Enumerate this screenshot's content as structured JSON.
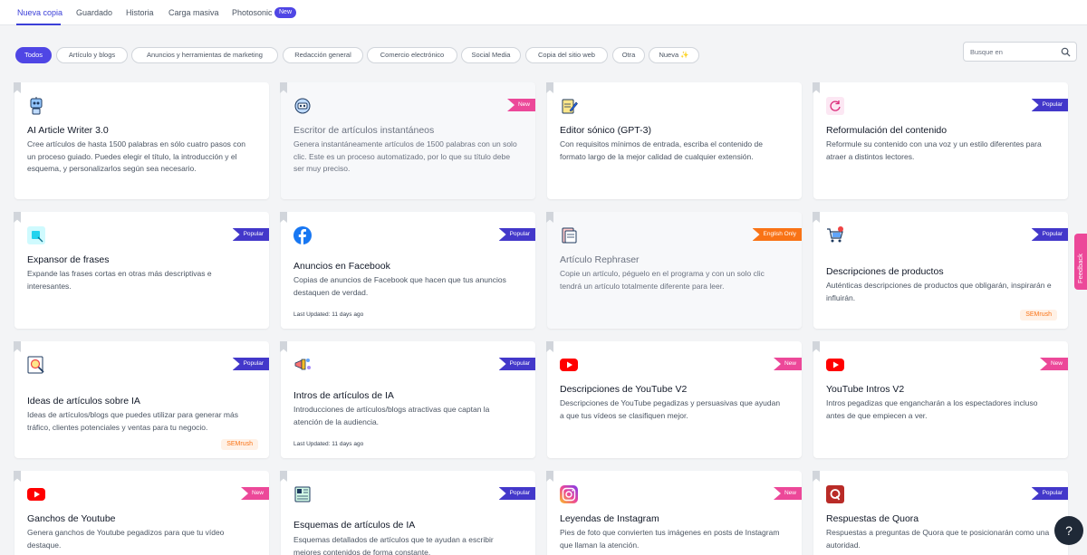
{
  "nav": {
    "tabs": [
      {
        "label": "Nueva copia",
        "active": true
      },
      {
        "label": "Guardado"
      },
      {
        "label": "Historia"
      },
      {
        "label": "Carga masiva"
      },
      {
        "label": "Photosonic"
      }
    ],
    "new_badge": "New"
  },
  "filters": [
    "Todos",
    "Artículo y blogs",
    "Anuncios y herramientas de marketing",
    "Redacción general",
    "Comercio electrónico",
    "Social Media",
    "Copia del sitio web",
    "Otra",
    "Nueva ✨"
  ],
  "search": {
    "placeholder": "Busque en"
  },
  "cards": [
    {
      "title": "AI Article Writer 3.0",
      "desc": "Cree artículos de hasta 1500 palabras en sólo cuatro pasos con un proceso guiado. Puedes elegir el título, la introducción y el esquema, y personalizarlos según sea necesario.",
      "icon": "robot-writer-icon"
    },
    {
      "title": "Escritor de artículos instantáneos",
      "desc": "Genera instantáneamente artículos de 1500 palabras con un solo clic. Este es un proceso automatizado, por lo que su título debe ser muy preciso.",
      "badge": "New",
      "icon": "robot-icon"
    },
    {
      "title": "Editor sónico (GPT-3)",
      "desc": "Con requisitos mínimos de entrada, escriba el contenido de formato largo de la mejor calidad de cualquier extensión.",
      "icon": "edit-document-icon"
    },
    {
      "title": "Reformulación del contenido",
      "desc": "Reformule su contenido con una voz y un estilo diferentes para atraer a distintos lectores.",
      "badge": "Popular",
      "icon": "refresh-icon"
    },
    {
      "title": "Expansor de frases",
      "desc": "Expande las frases cortas en otras más descriptivas e interesantes.",
      "badge": "Popular",
      "icon": "expand-icon"
    },
    {
      "title": "Anuncios en Facebook",
      "desc": "Copias de anuncios de Facebook que hacen que tus anuncios destaquen de verdad.",
      "badge": "Popular",
      "meta": "Last Updated: 11 days ago",
      "icon": "facebook-icon"
    },
    {
      "title": "Artículo Rephraser",
      "desc": "Copie un artículo, péguelo en el programa y con un solo clic tendrá un artículo totalmente diferente para leer.",
      "badge": "English Only",
      "icon": "document-icon"
    },
    {
      "title": "Descripciones de productos",
      "desc": "Auténticas descripciones de productos que obligarán, inspirarán e influirán.",
      "badge": "Popular",
      "tag": "SEMrush",
      "icon": "shopping-cart-icon"
    },
    {
      "title": "Ideas de artículos sobre IA",
      "desc": "Ideas de artículos/blogs que puedes utilizar para generar más tráfico, clientes potenciales y ventas para tu negocio.",
      "badge": "Popular",
      "tag": "SEMrush",
      "icon": "idea-search-icon"
    },
    {
      "title": "Intros de artículos de IA",
      "desc": "Introducciones de artículos/blogs atractivas que captan la atención de la audiencia.",
      "badge": "Popular",
      "meta": "Last Updated: 11 days ago",
      "icon": "megaphone-icon"
    },
    {
      "title": "Descripciones de YouTube V2",
      "desc": "Descripciones de YouTube pegadizas y persuasivas que ayudan a que tus vídeos se clasifiquen mejor.",
      "badge": "New",
      "icon": "youtube-icon"
    },
    {
      "title": "YouTube Intros V2",
      "desc": "Intros pegadizas que engancharán a los espectadores incluso antes de que empiecen a ver.",
      "badge": "New",
      "icon": "youtube-icon"
    },
    {
      "title": "Ganchos de Youtube",
      "desc": "Genera ganchos de Youtube pegadizos para que tu vídeo destaque.",
      "badge": "New",
      "icon": "youtube-icon"
    },
    {
      "title": "Esquemas de artículos de IA",
      "desc": "Esquemas detallados de artículos que te ayudan a escribir mejores contenidos de forma constante.",
      "badge": "Popular",
      "icon": "newspaper-icon"
    },
    {
      "title": "Leyendas de Instagram",
      "desc": "Pies de foto que convierten tus imágenes en posts de Instagram que llaman la atención.",
      "badge": "New",
      "icon": "instagram-icon"
    },
    {
      "title": "Respuestas de Quora",
      "desc": "Respuestas a preguntas de Quora que te posicionarán como una autoridad.",
      "badge": "Popular",
      "icon": "quora-icon"
    }
  ],
  "feedback": "Feedback",
  "help": "?"
}
